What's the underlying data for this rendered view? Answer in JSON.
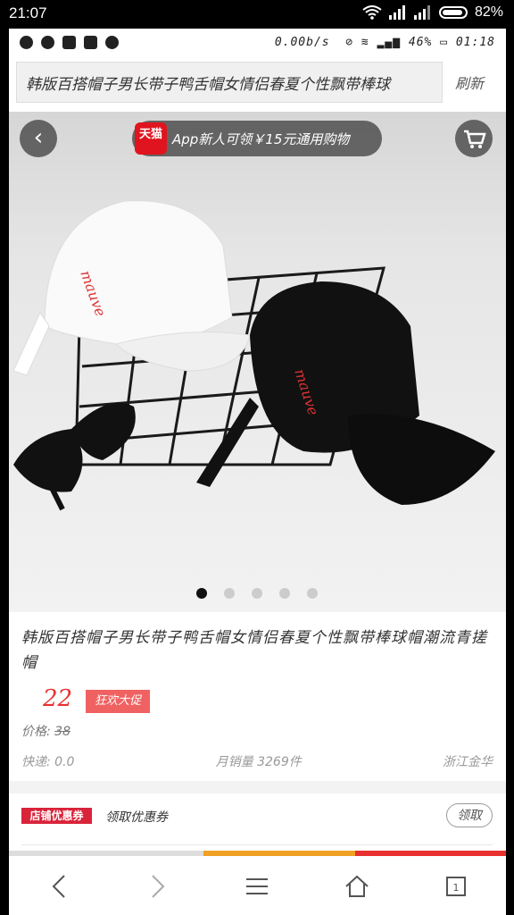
{
  "system_status": {
    "time": "21:07",
    "battery": "82%"
  },
  "inner_status": {
    "speed": "0.00b/s",
    "battery": "46%",
    "time": "01:18"
  },
  "url_bar": {
    "title": "韩版百搭帽子男长带子鸭舌帽女情侣春夏个性飘带棒球",
    "refresh_label": "刷新"
  },
  "hero": {
    "promo_badge": "天猫",
    "promo_text": "App新人可领￥15元通用购物",
    "carousel": {
      "count": 5,
      "active_index": 0
    }
  },
  "product": {
    "title": "韩版百搭帽子男长带子鸭舌帽女情侣春夏个性飘带棒球帽潮流青搓帽",
    "price": "22",
    "promo_tag": "狂欢大促",
    "orig_label": "价格:",
    "orig_price": "38",
    "shipping": "快递: 0.0",
    "monthly_sales": "月销量 3269件",
    "location": "浙江金华"
  },
  "coupon": {
    "badge": "店铺优惠券",
    "text": "领取优惠券",
    "button": "领取"
  },
  "colors": {
    "price_red": "#e8302f",
    "tmall_red": "#e0141e",
    "coupon_red": "#d9233a",
    "progress_orange": "#f0a023"
  }
}
